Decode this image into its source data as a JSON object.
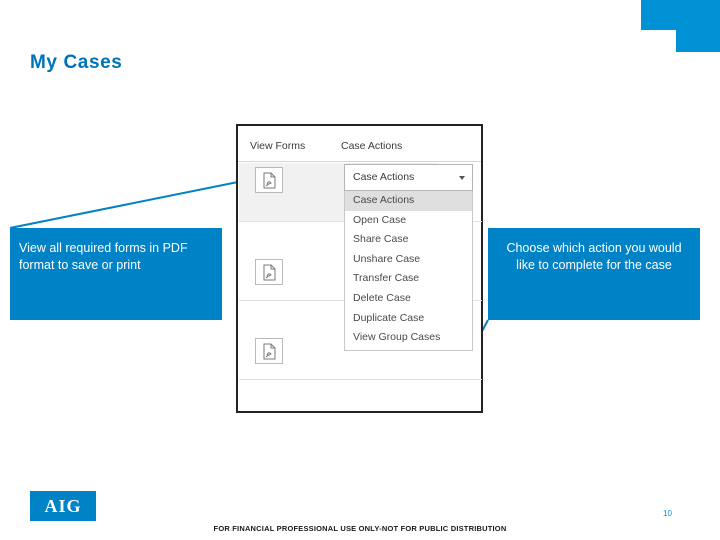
{
  "page": {
    "title": "My Cases",
    "slide_number": "10",
    "disclaimer": "FOR FINANCIAL PROFESSIONAL USE ONLY-NOT FOR PUBLIC DISTRIBUTION",
    "logo_text": "AIG",
    "accent_color": "#0092d4",
    "callout_color": "#0082c6",
    "title_color": "#0072b8"
  },
  "screenshot": {
    "column_headers": {
      "forms": "View Forms",
      "actions": "Case Actions"
    },
    "pdf_icon_name": "pdf-document-icon",
    "dropdown": {
      "selected": "Case Actions",
      "caret_icon": "chevron-down-icon",
      "options": [
        {
          "label": "Case Actions",
          "highlighted": true
        },
        {
          "label": "Open Case",
          "highlighted": false
        },
        {
          "label": "Share Case",
          "highlighted": false
        },
        {
          "label": "Unshare Case",
          "highlighted": false
        },
        {
          "label": "Transfer Case",
          "highlighted": false
        },
        {
          "label": "Delete Case",
          "highlighted": false
        },
        {
          "label": "Duplicate Case",
          "highlighted": false
        },
        {
          "label": "View Group Cases",
          "highlighted": false
        }
      ]
    }
  },
  "callouts": {
    "left": "View all required forms in PDF format to save or print",
    "right": "Choose which action you would like to complete for the case"
  }
}
